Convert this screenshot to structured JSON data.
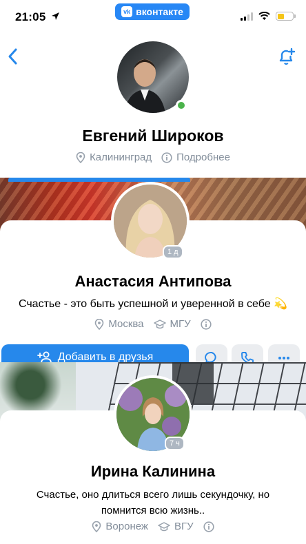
{
  "status_bar": {
    "time": "21:05",
    "app_label": "вконтакте",
    "vk_logo_text": "vk",
    "battery_level": 0.45,
    "battery_color": "#f5c518"
  },
  "header": {
    "back_icon": "chevron-left-icon",
    "notify_icon": "bell-plus-icon"
  },
  "profiles": [
    {
      "name": "Евгений Широков",
      "online": true,
      "city": "Калининград",
      "more": "Подробнее"
    },
    {
      "name": "Анастасия Антипова",
      "last_seen": "1 д",
      "status": "Счастье - это быть успешной и уверенной в себе 💫",
      "city": "Москва",
      "university": "МГУ",
      "add_friend": "Добавить в друзья"
    },
    {
      "name": "Ирина Калинина",
      "last_seen": "7 ч",
      "status": "Счастье, оно длиться всего лишь секундочку, но помнится всю жизнь..",
      "city": "Воронеж",
      "university": "ВГУ"
    }
  ],
  "colors": {
    "accent": "#2688eb",
    "secondary_text": "#818c99",
    "online": "#4bb34b",
    "button_gray": "#ebedf0"
  }
}
